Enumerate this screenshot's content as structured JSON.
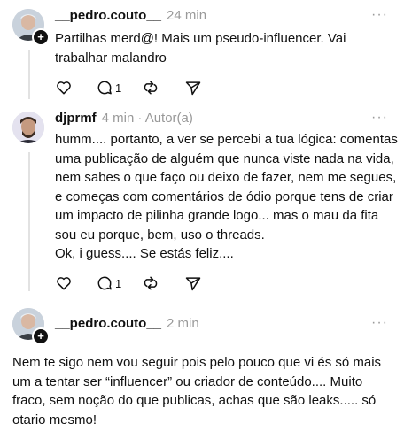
{
  "posts": [
    {
      "username": "__pedro.couto__",
      "time": "24 min",
      "author_tag": "",
      "text": "Partilhas merd@! Mais um pseudo-influencer. Vai\ntrabalhar malandro",
      "reply_count": "1"
    },
    {
      "username": "djprmf",
      "time": "4 min",
      "author_tag": "· Autor(a)",
      "text": "humm.... portanto, a ver se percebi a tua lógica: comentas\numa publicação de alguém que nunca viste nada na vida,\nnem sabes o que faço ou deixo de fazer, nem me segues,\ne começas com comentários de ódio porque tens de criar\num impacto de pilinha grande logo... mas o mau da fita\nsou eu porque, bem, uso o threads.\nOk, i guess.... Se estás feliz....",
      "reply_count": "1"
    },
    {
      "username": "__pedro.couto__",
      "time": "2 min",
      "author_tag": "",
      "text": "Nem te sigo nem vou seguir pois pelo pouco que vi és só mais\num a tentar ser “influencer” ou criador de conteúdo.... Muito\nfraco, sem noção do que publicas, achas que são leaks..... só\notario mesmo!"
    }
  ],
  "icons": {
    "follow": "+",
    "more": "···",
    "like": "heart-icon",
    "reply": "comment-icon",
    "repost": "repost-icon",
    "share": "send-icon"
  },
  "colors": {
    "text": "#101010",
    "muted": "#999999",
    "line": "#e2e2e2"
  }
}
